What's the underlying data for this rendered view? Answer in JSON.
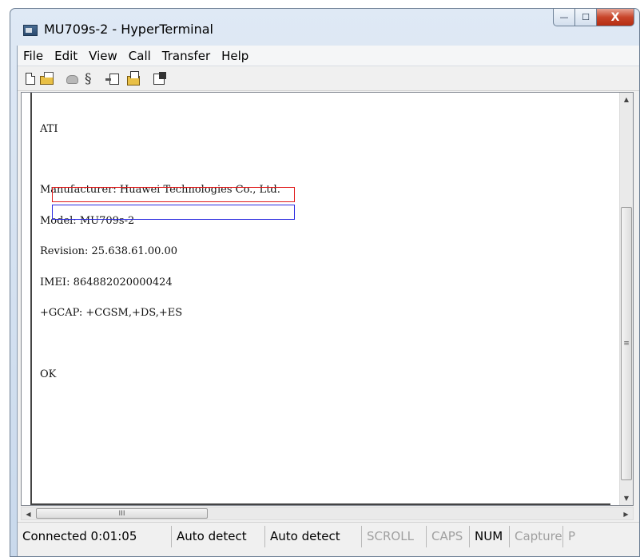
{
  "window": {
    "title": "MU709s-2 - HyperTerminal",
    "buttons": {
      "minimize": "—",
      "maximize": "☐",
      "close": "X"
    }
  },
  "menu": [
    "File",
    "Edit",
    "View",
    "Call",
    "Transfer",
    "Help"
  ],
  "toolbar": {
    "icons": [
      "new-icon",
      "open-icon",
      "call-icon",
      "disconnect-icon",
      "send-icon",
      "receive-icon",
      "properties-icon"
    ]
  },
  "terminal": {
    "lines": [
      "ATI",
      "",
      "Manufacturer: Huawei Technologies Co., Ltd.",
      "Model: MU709s-2",
      "Revision: 25.638.61.00.00",
      "IMEI: 864882020000424",
      "+GCAP: +CGSM,+DS,+ES",
      "",
      "OK"
    ],
    "highlight_colors": {
      "imei": "#e01b1b",
      "gcap": "#2a2ae0"
    }
  },
  "scrollbar": {
    "grip": "≡",
    "hgrip": "III"
  },
  "statusbar": {
    "connected": "Connected 0:01:05",
    "detect1": "Auto detect",
    "detect2": "Auto detect",
    "scroll": "SCROLL",
    "caps": "CAPS",
    "num": "NUM",
    "capture": "Capture",
    "print": "P"
  }
}
